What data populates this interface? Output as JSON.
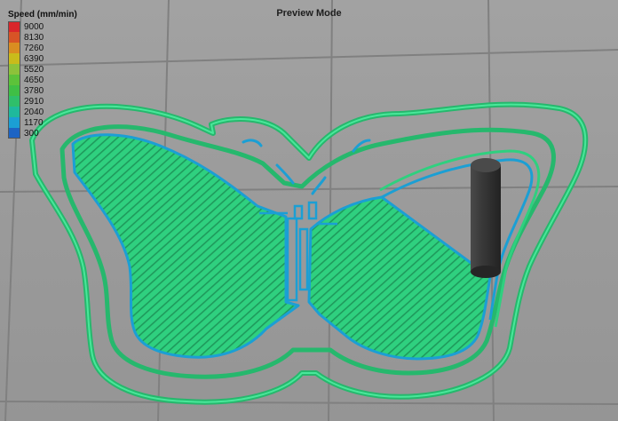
{
  "header": {
    "mode": "Preview Mode"
  },
  "legend": {
    "title": "Speed (mm/min)",
    "entries": [
      {
        "value": "9000",
        "color": "#d9262b"
      },
      {
        "value": "8130",
        "color": "#d75426"
      },
      {
        "value": "7260",
        "color": "#d98d21"
      },
      {
        "value": "6390",
        "color": "#c9bb1b"
      },
      {
        "value": "5520",
        "color": "#8dc23a"
      },
      {
        "value": "4650",
        "color": "#5cc23a"
      },
      {
        "value": "3780",
        "color": "#3fbf45"
      },
      {
        "value": "2910",
        "color": "#2fbf6a"
      },
      {
        "value": "2040",
        "color": "#1fb99c"
      },
      {
        "value": "1170",
        "color": "#1b9fd4"
      },
      {
        "value": "300",
        "color": "#1d64c4"
      }
    ]
  },
  "colors": {
    "bed": "#9c9c9c",
    "grid": "#7c7c7c",
    "infill": "#2fd07f",
    "infill_stripe": "#23a862",
    "perimeter_inner": "#1b9fd4",
    "perimeter_outer": "#2fd07f",
    "cylinder": "#3a3a3a"
  },
  "objects": {
    "print": "butterfly-toolpath",
    "purge_tower": "cylinder"
  }
}
